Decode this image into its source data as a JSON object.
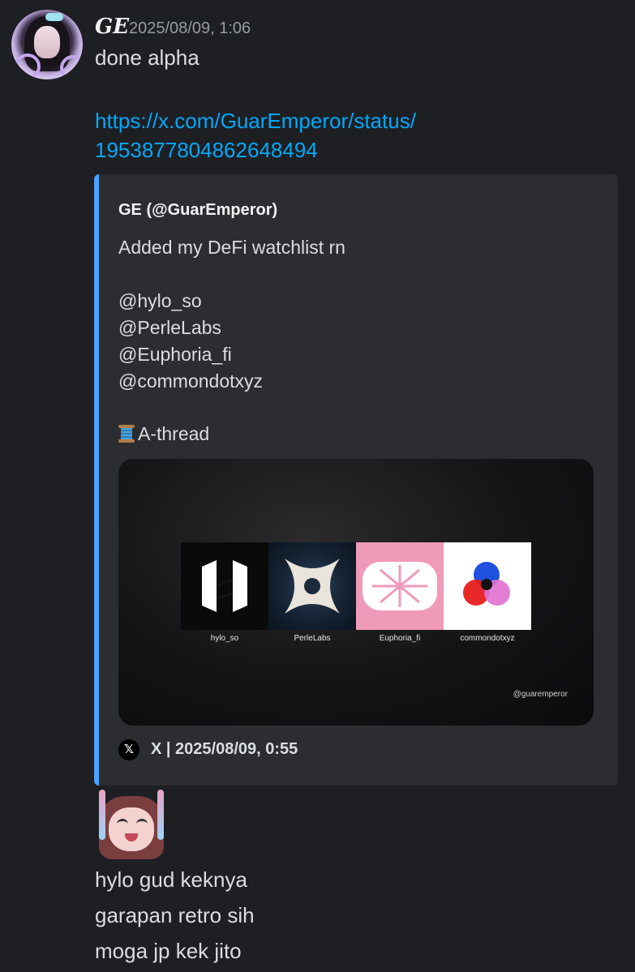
{
  "message1": {
    "author": "GE",
    "timestamp": "2025/08/09, 1:06",
    "text": "done alpha",
    "link_line1": "https://x.com/GuarEmperor/status/",
    "link_line2": "1953877804862648494"
  },
  "embed": {
    "author": "GE (@GuarEmperor)",
    "lines": [
      "Added my DeFi watchlist rn",
      "@hylo_so",
      "@PerleLabs",
      "@Euphoria_fi",
      "@commondotxyz",
      "A-thread"
    ],
    "image": {
      "tiles": [
        "hylo_so",
        "PerleLabs",
        "Euphoria_fi",
        "commondotxyz"
      ],
      "watermark": "@guaremperor"
    },
    "footer_icon": "x-logo-icon",
    "footer": "X | 2025/08/09, 0:55"
  },
  "message2": {
    "sticker": "anime-girl-glowsticks-sticker",
    "lines": [
      "hylo gud keknya",
      "garapan retro sih",
      "moga jp kek jito"
    ]
  },
  "colors": {
    "background": "#1e1f22",
    "embed_bg": "#2b2d31",
    "embed_accent": "#4e9eff",
    "link": "#00a8fc",
    "muted": "#949ba4"
  }
}
